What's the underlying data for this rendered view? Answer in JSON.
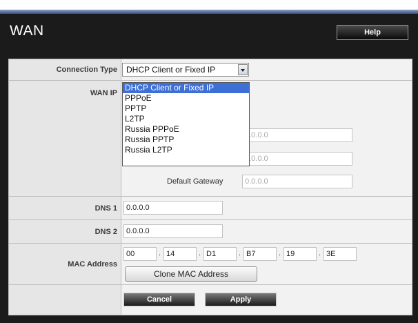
{
  "page": {
    "title": "WAN",
    "help_label": "Help"
  },
  "form": {
    "connection_type": {
      "label": "Connection Type",
      "selected": "DHCP Client or Fixed IP",
      "options": [
        "DHCP Client or Fixed IP",
        "PPPoE",
        "PPTP",
        "L2TP",
        "Russia PPPoE",
        "Russia PPTP",
        "Russia L2TP"
      ]
    },
    "wan_ip": {
      "label": "WAN IP",
      "field1_value": "0.0.0.0",
      "field2_value": "0.0.0.0",
      "default_gateway_label": "Default Gateway",
      "default_gateway_value": "0.0.0.0"
    },
    "dns1": {
      "label": "DNS 1",
      "value": "0.0.0.0"
    },
    "dns2": {
      "label": "DNS 2",
      "value": "0.0.0.0"
    },
    "mac": {
      "label": "MAC Address",
      "octets": [
        "00",
        "14",
        "D1",
        "B7",
        "19",
        "3E"
      ],
      "separator": ".",
      "clone_label": "Clone MAC Address"
    }
  },
  "actions": {
    "cancel_label": "Cancel",
    "apply_label": "Apply"
  }
}
